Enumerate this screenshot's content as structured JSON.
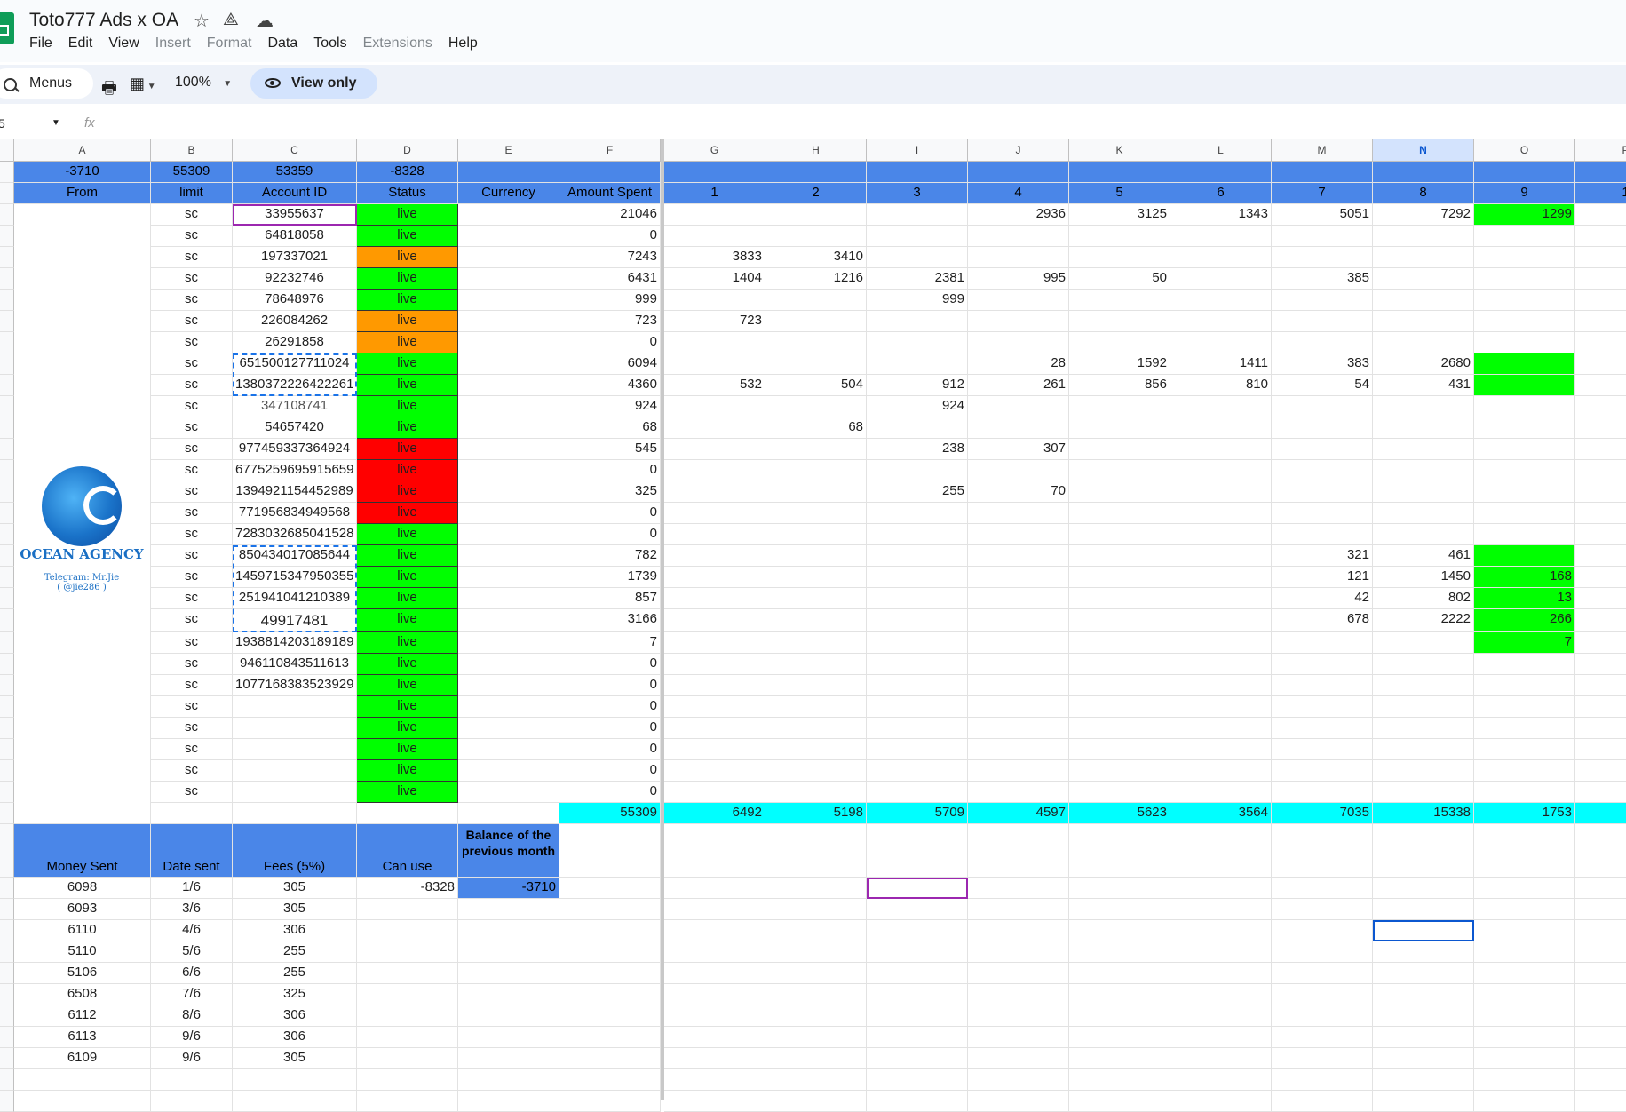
{
  "app": {
    "title": "Toto777 Ads x OA",
    "menu": [
      "File",
      "Edit",
      "View",
      "Insert",
      "Format",
      "Data",
      "Tools",
      "Extensions",
      "Help"
    ],
    "menu_disabled": [
      "Insert",
      "Format",
      "Extensions"
    ]
  },
  "toolbar": {
    "menus_label": "Menus",
    "zoom": "100%",
    "view_only_label": "View only"
  },
  "formula_bar": {
    "name_box": "5",
    "fx": "fx"
  },
  "columns": [
    "A",
    "B",
    "C",
    "D",
    "E",
    "F",
    "G",
    "H",
    "I",
    "J",
    "K",
    "L",
    "M",
    "N",
    "O",
    "P"
  ],
  "summary_row": {
    "A": "-3710",
    "B": "55309",
    "C": "53359",
    "D": "-8328"
  },
  "headers": {
    "A": "From",
    "B": "limit",
    "C": "Account ID",
    "D": "Status",
    "E": "Currency",
    "F": "Amount Spent",
    "days": [
      "1",
      "2",
      "3",
      "4",
      "5",
      "6",
      "7",
      "8",
      "9",
      "1"
    ]
  },
  "logo": {
    "name": "OCEAN AGENCY",
    "telegram": "Telegram: Mr.Jie",
    "handle": "( @jie286 )"
  },
  "accounts": [
    {
      "limit": "sc",
      "id": "33955637",
      "status": "live",
      "status_color": "green",
      "spent": "21046",
      "days": [
        "",
        "",
        "",
        "2936",
        "3125",
        "1343",
        "5051",
        "7292",
        "1299"
      ],
      "o_green": true
    },
    {
      "limit": "sc",
      "id": "64818058",
      "status": "live",
      "status_color": "green",
      "spent": "0",
      "days": [
        "",
        "",
        "",
        "",
        "",
        "",
        "",
        "",
        ""
      ]
    },
    {
      "limit": "sc",
      "id": "197337021",
      "status": "live",
      "status_color": "orange",
      "spent": "7243",
      "days": [
        "3833",
        "3410",
        "",
        "",
        "",
        "",
        "",
        "",
        ""
      ]
    },
    {
      "limit": "sc",
      "id": "92232746",
      "status": "live",
      "status_color": "green",
      "spent": "6431",
      "days": [
        "1404",
        "1216",
        "2381",
        "995",
        "50",
        "",
        "385",
        "",
        ""
      ]
    },
    {
      "limit": "sc",
      "id": "78648976",
      "status": "live",
      "status_color": "green",
      "spent": "999",
      "days": [
        "",
        "",
        "999",
        "",
        "",
        "",
        "",
        "",
        ""
      ]
    },
    {
      "limit": "sc",
      "id": "226084262",
      "status": "live",
      "status_color": "orange",
      "spent": "723",
      "days": [
        "723",
        "",
        "",
        "",
        "",
        "",
        "",
        "",
        ""
      ]
    },
    {
      "limit": "sc",
      "id": "26291858",
      "status": "live",
      "status_color": "orange",
      "spent": "0",
      "days": [
        "",
        "",
        "",
        "",
        "",
        "",
        "",
        "",
        ""
      ]
    },
    {
      "limit": "sc",
      "id": "651500127711024",
      "status": "live",
      "status_color": "green",
      "spent": "6094",
      "days": [
        "",
        "",
        "",
        "28",
        "1592",
        "1411",
        "383",
        "2680",
        ""
      ],
      "o_green": true
    },
    {
      "limit": "sc",
      "id": "1380372226422261",
      "status": "live",
      "status_color": "green",
      "spent": "4360",
      "days": [
        "532",
        "504",
        "912",
        "261",
        "856",
        "810",
        "54",
        "431",
        ""
      ],
      "o_green": true
    },
    {
      "limit": "sc",
      "id": "347108741",
      "status": "live",
      "status_color": "green",
      "spent": "924",
      "days": [
        "",
        "",
        "924",
        "",
        "",
        "",
        "",
        "",
        ""
      ]
    },
    {
      "limit": "sc",
      "id": "54657420",
      "status": "live",
      "status_color": "green",
      "spent": "68",
      "days": [
        "",
        "68",
        "",
        "",
        "",
        "",
        "",
        "",
        ""
      ]
    },
    {
      "limit": "sc",
      "id": "977459337364924",
      "status": "live",
      "status_color": "red",
      "spent": "545",
      "days": [
        "",
        "",
        "238",
        "307",
        "",
        "",
        "",
        "",
        ""
      ]
    },
    {
      "limit": "sc",
      "id": "6775259695915659",
      "status": "live",
      "status_color": "red",
      "spent": "0",
      "days": [
        "",
        "",
        "",
        "",
        "",
        "",
        "",
        "",
        ""
      ]
    },
    {
      "limit": "sc",
      "id": "1394921154452989",
      "status": "live",
      "status_color": "red",
      "spent": "325",
      "days": [
        "",
        "",
        "255",
        "70",
        "",
        "",
        "",
        "",
        ""
      ]
    },
    {
      "limit": "sc",
      "id": "771956834949568",
      "status": "live",
      "status_color": "red",
      "spent": "0",
      "days": [
        "",
        "",
        "",
        "",
        "",
        "",
        "",
        "",
        ""
      ]
    },
    {
      "limit": "sc",
      "id": "7283032685041528",
      "status": "live",
      "status_color": "green",
      "spent": "0",
      "days": [
        "",
        "",
        "",
        "",
        "",
        "",
        "",
        "",
        ""
      ]
    },
    {
      "limit": "sc",
      "id": "850434017085644",
      "status": "live",
      "status_color": "green",
      "spent": "782",
      "days": [
        "",
        "",
        "",
        "",
        "",
        "",
        "321",
        "461",
        ""
      ],
      "o_green": true
    },
    {
      "limit": "sc",
      "id": "1459715347950355",
      "status": "live",
      "status_color": "green",
      "spent": "1739",
      "days": [
        "",
        "",
        "",
        "",
        "",
        "",
        "121",
        "1450",
        "168"
      ],
      "o_green": true
    },
    {
      "limit": "sc",
      "id": "251941041210389",
      "status": "live",
      "status_color": "green",
      "spent": "857",
      "days": [
        "",
        "",
        "",
        "",
        "",
        "",
        "42",
        "802",
        "13"
      ],
      "o_green": true
    },
    {
      "limit": "sc",
      "id": "49917481",
      "status": "live",
      "status_color": "green",
      "spent": "3166",
      "days": [
        "",
        "",
        "",
        "",
        "",
        "",
        "678",
        "2222",
        "266"
      ],
      "o_green": true
    },
    {
      "limit": "sc",
      "id": "1938814203189189",
      "status": "live",
      "status_color": "green",
      "spent": "7",
      "days": [
        "",
        "",
        "",
        "",
        "",
        "",
        "",
        "",
        "7"
      ],
      "o_green": true
    },
    {
      "limit": "sc",
      "id": "946110843511613",
      "status": "live",
      "status_color": "green",
      "spent": "0",
      "days": [
        "",
        "",
        "",
        "",
        "",
        "",
        "",
        "",
        ""
      ]
    },
    {
      "limit": "sc",
      "id": "1077168383523929",
      "status": "live",
      "status_color": "green",
      "spent": "0",
      "days": [
        "",
        "",
        "",
        "",
        "",
        "",
        "",
        "",
        ""
      ]
    },
    {
      "limit": "sc",
      "id": "",
      "status": "live",
      "status_color": "green",
      "spent": "0",
      "days": [
        "",
        "",
        "",
        "",
        "",
        "",
        "",
        "",
        ""
      ]
    },
    {
      "limit": "sc",
      "id": "",
      "status": "live",
      "status_color": "green",
      "spent": "0",
      "days": [
        "",
        "",
        "",
        "",
        "",
        "",
        "",
        "",
        ""
      ]
    },
    {
      "limit": "sc",
      "id": "",
      "status": "live",
      "status_color": "green",
      "spent": "0",
      "days": [
        "",
        "",
        "",
        "",
        "",
        "",
        "",
        "",
        ""
      ]
    },
    {
      "limit": "sc",
      "id": "",
      "status": "live",
      "status_color": "green",
      "spent": "0",
      "days": [
        "",
        "",
        "",
        "",
        "",
        "",
        "",
        "",
        ""
      ]
    },
    {
      "limit": "sc",
      "id": "",
      "status": "live",
      "status_color": "green",
      "spent": "0",
      "days": [
        "",
        "",
        "",
        "",
        "",
        "",
        "",
        "",
        ""
      ]
    }
  ],
  "totals": {
    "spent": "55309",
    "days": [
      "6492",
      "5198",
      "5709",
      "4597",
      "5623",
      "3564",
      "7035",
      "15338",
      "1753"
    ]
  },
  "payments_header": {
    "A": "Money Sent",
    "B": "Date sent",
    "C": "Fees (5%)",
    "D": "Can use",
    "E": "Balance of the previous month"
  },
  "payments_balance": {
    "can_use": "-8328",
    "previous": "-3710"
  },
  "payments": [
    {
      "money": "6098",
      "date": "1/6",
      "fee": "305"
    },
    {
      "money": "6093",
      "date": "3/6",
      "fee": "305"
    },
    {
      "money": "6110",
      "date": "4/6",
      "fee": "306"
    },
    {
      "money": "5110",
      "date": "5/6",
      "fee": "255"
    },
    {
      "money": "5106",
      "date": "6/6",
      "fee": "255"
    },
    {
      "money": "6508",
      "date": "7/6",
      "fee": "325"
    },
    {
      "money": "6112",
      "date": "8/6",
      "fee": "306"
    },
    {
      "money": "6113",
      "date": "9/6",
      "fee": "306"
    },
    {
      "money": "6109",
      "date": "9/6",
      "fee": "305"
    }
  ],
  "colors": {
    "header_blue": "#4a86e8",
    "green": "#00ff00",
    "orange": "#ff9900",
    "red": "#ff0000",
    "cyan": "#00ffff",
    "selection_blue": "#0b57d0"
  }
}
